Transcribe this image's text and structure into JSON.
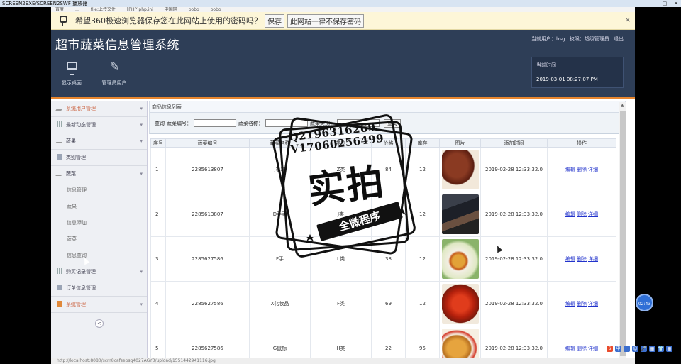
{
  "player": {
    "title": "SCREEN2EXE/SCREEN2SWF 播放器",
    "buttons": [
      "—",
      "□",
      "✕"
    ]
  },
  "favbar": [
    "百度",
    "…",
    "file;上传文件",
    "[PHP]php.ini",
    "中国网",
    "bobo",
    "bobo"
  ],
  "password_bar": {
    "message": "希望360极速浏览器保存您在此网站上使用的密码吗？",
    "save_label": "保存",
    "never_label": "此网站一律不保存密码",
    "close": "×"
  },
  "header": {
    "title": "超市蔬菜信息管理系统",
    "user_label": "当前用户：hsg",
    "role_label": "权限：超级管理员",
    "logout_label": "退出",
    "tools": [
      {
        "icon": "monitor-icon",
        "label": "显示桌面"
      },
      {
        "icon": "pencil-icon",
        "label": "管理员用户"
      }
    ],
    "time_label": "当前时间",
    "time_value": "2019-03-01 08:27:07 PM"
  },
  "sidebar": {
    "items": [
      {
        "label": "系统用户管理",
        "kind": "item",
        "icon": "pencil-icon",
        "active": true
      },
      {
        "label": "最新动态管理",
        "kind": "item",
        "icon": "grid-icon",
        "active": false
      },
      {
        "label": "蔬果",
        "kind": "item",
        "icon": "pencil-icon",
        "active": false
      },
      {
        "label": "类别管理",
        "kind": "item",
        "icon": "square-icon",
        "active": false
      },
      {
        "label": "蔬菜",
        "kind": "item",
        "icon": "pencil-icon",
        "active": false
      },
      {
        "label": "信息管理",
        "kind": "sub",
        "icon": "",
        "active": false
      },
      {
        "label": "蔬果",
        "kind": "sub",
        "icon": "",
        "active": false
      },
      {
        "label": "信息添加",
        "kind": "sub",
        "icon": "",
        "active": false
      },
      {
        "label": "蔬菜",
        "kind": "sub",
        "icon": "",
        "active": false
      },
      {
        "label": "信息查询",
        "kind": "sub",
        "icon": "",
        "active": false
      },
      {
        "label": "购买记录管理",
        "kind": "item",
        "icon": "grid-icon",
        "active": false
      },
      {
        "label": "订单信息管理",
        "kind": "item",
        "icon": "square-icon",
        "active": false
      },
      {
        "label": "系统管理",
        "kind": "item",
        "icon": "orange-icon",
        "active": true
      }
    ],
    "toggle": "<"
  },
  "content": {
    "panel_title": "商品信息列表",
    "query": {
      "label": "查询",
      "field1_label": "蔬菜编号：",
      "field2_label": "蔬菜名称：",
      "field3_label": "蔬菜类别：",
      "button": "查询"
    },
    "columns": [
      "序号",
      "蔬菜编号",
      "蔬菜名称",
      "类别",
      "价格",
      "库存",
      "图片",
      "添加时间",
      "操作"
    ],
    "rows": [
      {
        "no": "1",
        "code": "2285613807",
        "name": "J毛笔",
        "category": "Z类",
        "price": "84",
        "stock": "12",
        "img": "food-image",
        "time": "2019-02-28 12:33:32.0"
      },
      {
        "no": "2",
        "code": "2285613807",
        "name": "D手表",
        "category": "J类",
        "price": "",
        "stock": "12",
        "img": "food-image",
        "time": "2019-02-28 12:33:32.0"
      },
      {
        "no": "3",
        "code": "2285627586",
        "name": "F手",
        "category": "L类",
        "price": "38",
        "stock": "12",
        "img": "food-image",
        "time": "2019-02-28 12:33:32.0"
      },
      {
        "no": "4",
        "code": "2285627586",
        "name": "X化妆品",
        "category": "F类",
        "price": "69",
        "stock": "12",
        "img": "food-image",
        "time": "2019-02-28 12:33:32.0"
      },
      {
        "no": "5",
        "code": "2285627586",
        "name": "G鼠标",
        "category": "H类",
        "price": "22",
        "stock": "95",
        "img": "food-image",
        "time": "2019-02-28 12:33:32.0"
      }
    ],
    "actions": [
      "编辑",
      "删除",
      "详细"
    ]
  },
  "statusbar": "http://localhost:8080/scm8cafsebsq4027AGY3/upload/1551442941116.jpg",
  "watermark": {
    "qq": "Q2196316269",
    "v": "V17060256499",
    "big": "实拍",
    "band": "全微程序"
  },
  "overlay": {
    "clock_badge": "02:43",
    "tray": [
      "S",
      "中",
      "·",
      "☺",
      "🎤",
      "▦",
      "👕",
      "▦"
    ]
  }
}
